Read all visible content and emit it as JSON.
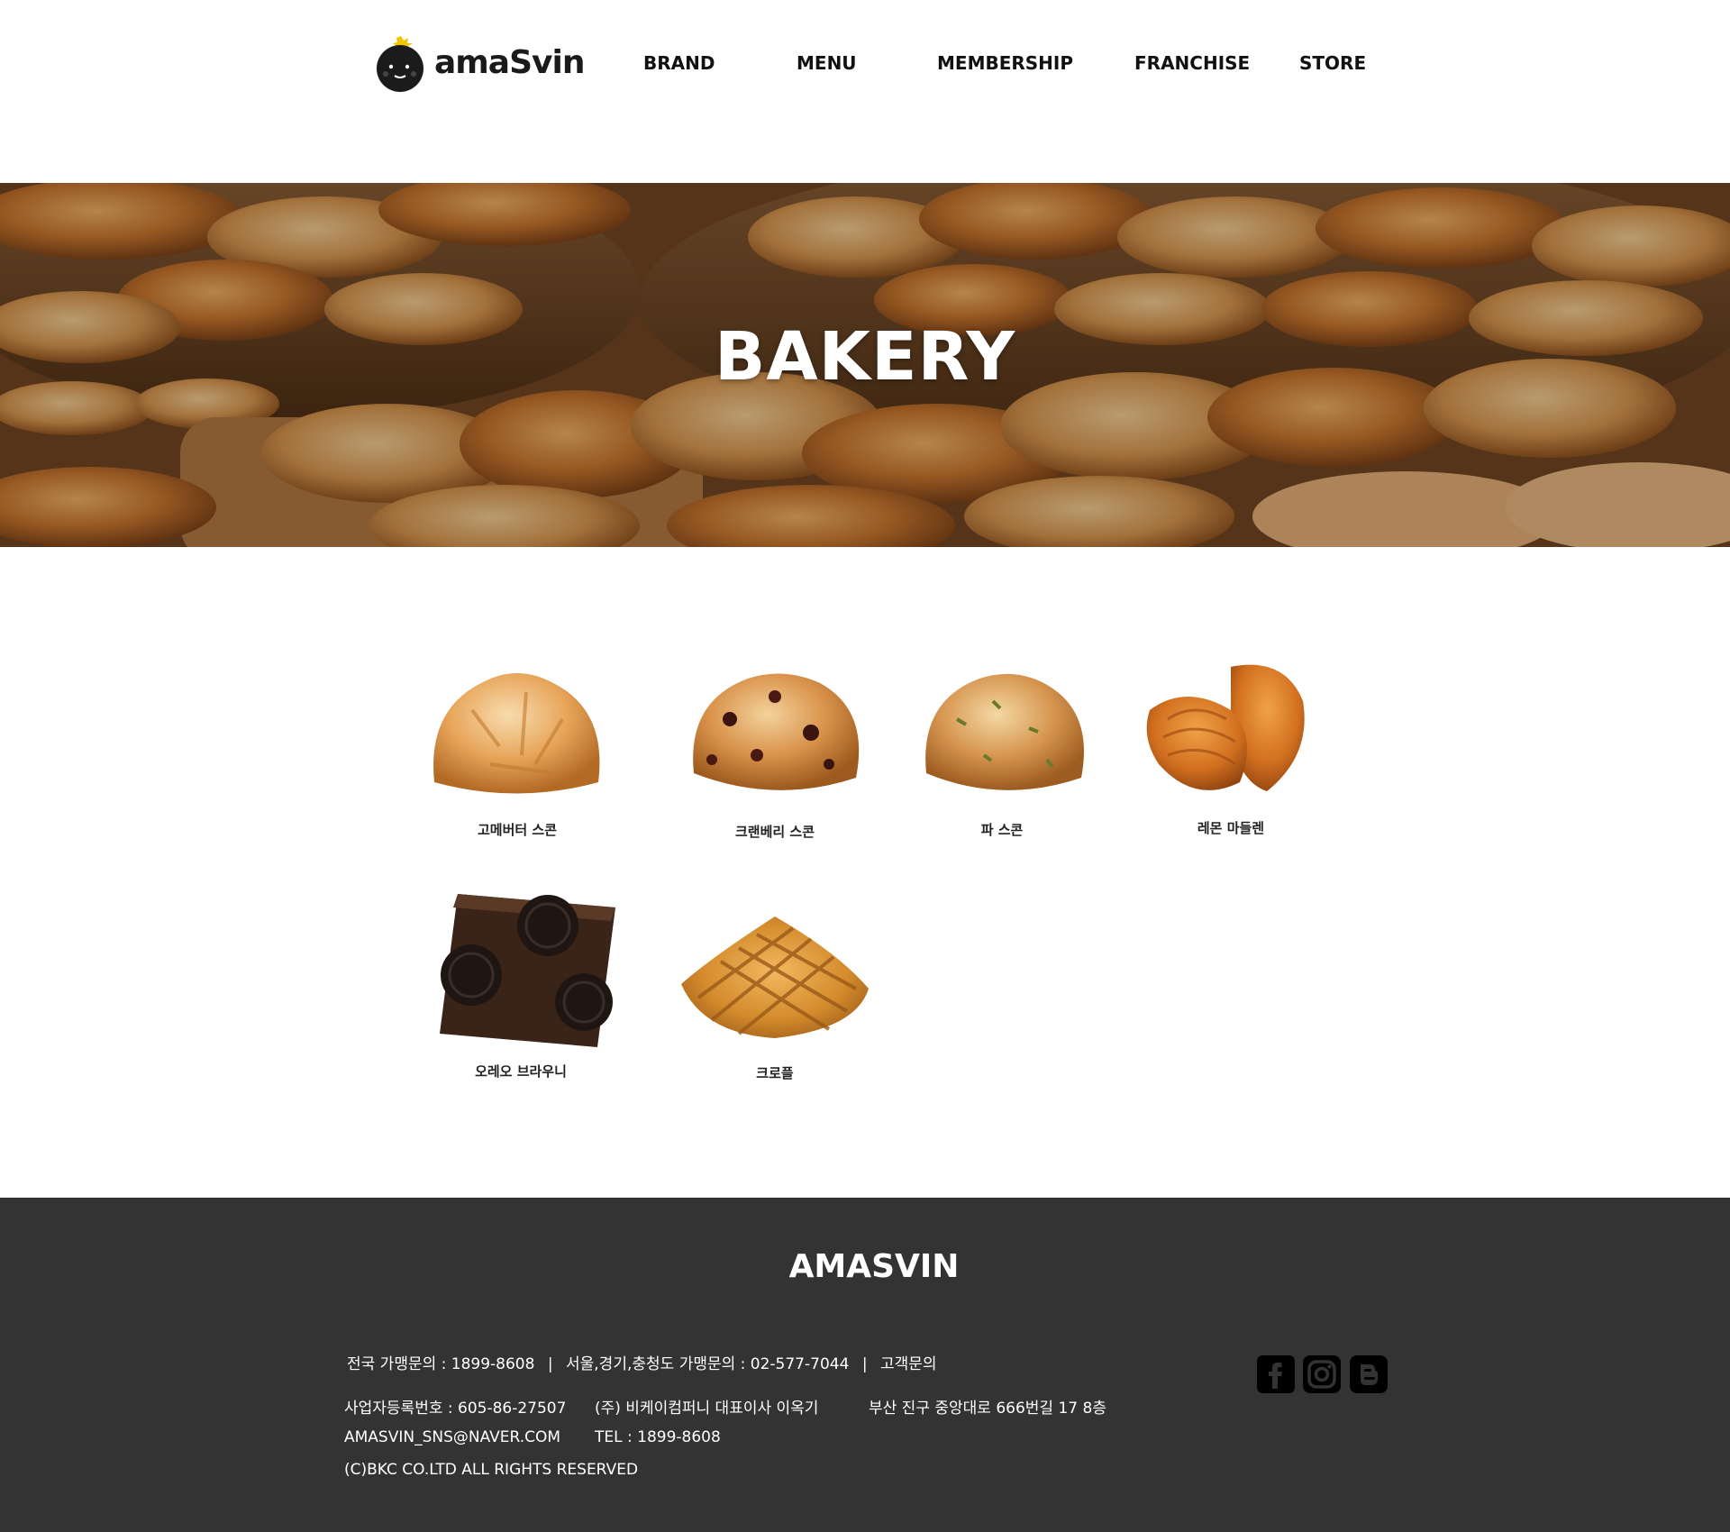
{
  "header": {
    "logo_text": "amaSvin",
    "nav": [
      {
        "label": "BRAND"
      },
      {
        "label": "MENU"
      },
      {
        "label": "MEMBERSHIP"
      },
      {
        "label": "FRANCHISE"
      },
      {
        "label": "STORE"
      }
    ]
  },
  "hero": {
    "title": "BAKERY"
  },
  "products": [
    {
      "name": "고메버터 스콘",
      "icon": "scone-icon"
    },
    {
      "name": "크랜베리 스콘",
      "icon": "cranberry-scone-icon"
    },
    {
      "name": "파 스콘",
      "icon": "green-onion-scone-icon"
    },
    {
      "name": "레몬 마들렌",
      "icon": "madeleine-icon"
    },
    {
      "name": "오레오 브라우니",
      "icon": "brownie-icon"
    },
    {
      "name": "크로플",
      "icon": "croffle-icon"
    }
  ],
  "footer": {
    "brand": "AMASVIN",
    "contact": {
      "nationwide": "전국 가맹문의 : 1899-8608",
      "regional": "서울,경기,충청도 가맹문의 : 02-577-7044",
      "separator": "|",
      "customer": "고객문의"
    },
    "business_number": "사업자등록번호 : 605-86-27507",
    "company": "(주) 비케이컴퍼니 대표이사 이옥기",
    "address": "부산 진구 중앙대로 666번길 17 8층",
    "email": "AMASVIN_SNS@NAVER.COM",
    "tel": "TEL : 1899-8608",
    "copyright": "(C)BKC CO.LTD ALL RIGHTS RESERVED",
    "social": [
      {
        "icon": "facebook-icon"
      },
      {
        "icon": "instagram-icon"
      },
      {
        "icon": "blogger-icon"
      }
    ]
  },
  "colors": {
    "footer_bg": "#333333",
    "hero_text": "#ffffff",
    "nav_text": "#111111"
  }
}
